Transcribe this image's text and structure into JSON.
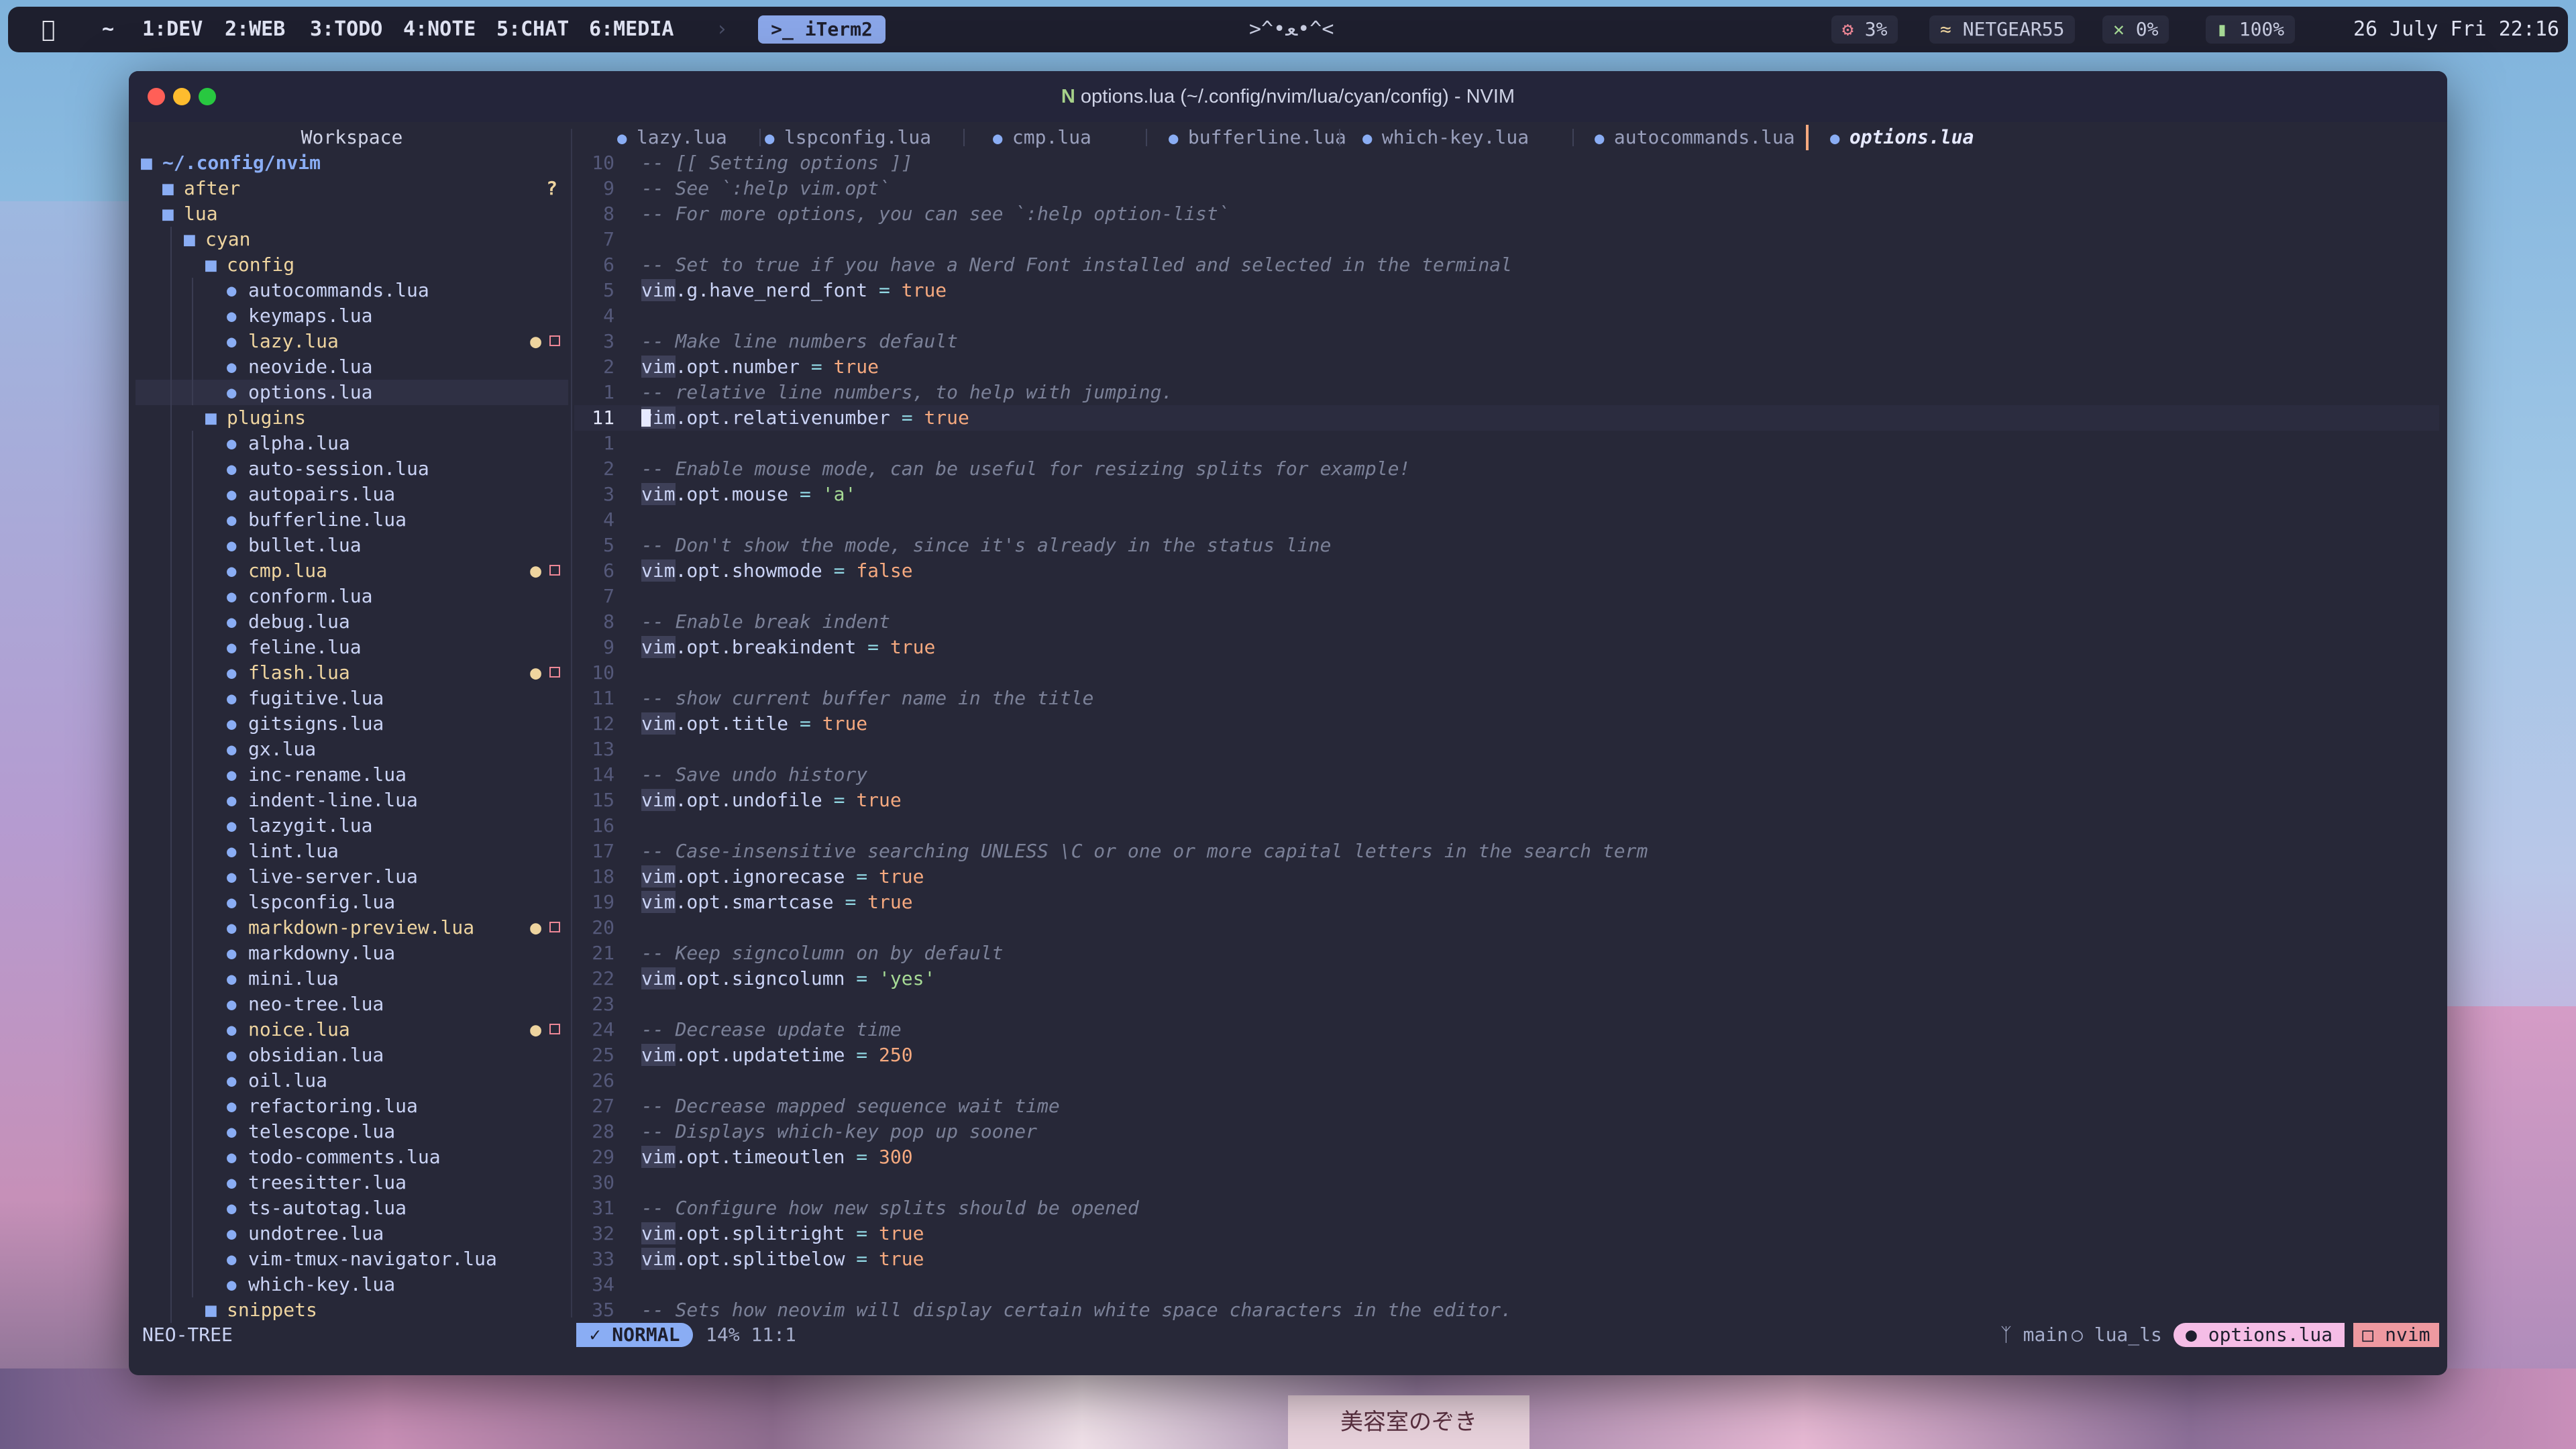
{
  "menubar": {
    "home": "~",
    "workspaces": [
      "1:DEV",
      "2:WEB",
      "3:TODO",
      "4:NOTE",
      "5:CHAT",
      "6:MEDIA"
    ],
    "active_app": "iTerm2",
    "kaomoji": ">^•ﻌ•^<",
    "cpu": "3%",
    "wifi": "NETGEAR55",
    "volume": "0%",
    "battery": "100%",
    "clock": "26 July Fri 22:16"
  },
  "window": {
    "title": "options.lua (~/.config/nvim/lua/cyan/config) - NVIM"
  },
  "sidebar": {
    "title": "Workspace",
    "root": "~/.config/nvim",
    "after": "after",
    "lua": "lua",
    "cyan": "cyan",
    "config": "config",
    "config_files": [
      "autocommands.lua",
      "keymaps.lua",
      "lazy.lua",
      "neovide.lua",
      "options.lua"
    ],
    "plugins": "plugins",
    "plugin_files": [
      "alpha.lua",
      "auto-session.lua",
      "autopairs.lua",
      "bufferline.lua",
      "bullet.lua",
      "cmp.lua",
      "conform.lua",
      "debug.lua",
      "feline.lua",
      "flash.lua",
      "fugitive.lua",
      "gitsigns.lua",
      "gx.lua",
      "inc-rename.lua",
      "indent-line.lua",
      "lazygit.lua",
      "lint.lua",
      "live-server.lua",
      "lspconfig.lua",
      "markdown-preview.lua",
      "markdowny.lua",
      "mini.lua",
      "neo-tree.lua",
      "noice.lua",
      "obsidian.lua",
      "oil.lua",
      "refactoring.lua",
      "telescope.lua",
      "todo-comments.lua",
      "treesitter.lua",
      "ts-autotag.lua",
      "undotree.lua",
      "vim-tmux-navigator.lua",
      "which-key.lua"
    ],
    "snippets": "snippets",
    "modified": [
      "lazy.lua",
      "cmp.lua",
      "flash.lua",
      "markdown-preview.lua",
      "noice.lua"
    ],
    "unknown_marker": "?"
  },
  "tabs": [
    "lazy.lua",
    "lspconfig.lua",
    "cmp.lua",
    "bufferline.lua",
    "which-key.lua",
    "autocommands.lua",
    "options.lua"
  ],
  "active_tab": "options.lua",
  "editor": {
    "lines": [
      {
        "n": "10",
        "t": "-- [[ Setting options ]]"
      },
      {
        "n": "9",
        "t": "-- See `:help vim.opt`"
      },
      {
        "n": "8",
        "t": "-- For more options, you can see `:help option-list`"
      },
      {
        "n": "7",
        "t": ""
      },
      {
        "n": "6",
        "t": "-- Set to true if you have a Nerd Font installed and selected in the terminal"
      },
      {
        "n": "5",
        "t": "vim.g.have_nerd_font = true"
      },
      {
        "n": "4",
        "t": ""
      },
      {
        "n": "3",
        "t": "-- Make line numbers default"
      },
      {
        "n": "2",
        "t": "vim.opt.number = true"
      },
      {
        "n": "1",
        "t": "-- relative line numbers, to help with jumping."
      },
      {
        "n": "11",
        "t": "vim.opt.relativenumber = true"
      },
      {
        "n": "1",
        "t": ""
      },
      {
        "n": "2",
        "t": "-- Enable mouse mode, can be useful for resizing splits for example!"
      },
      {
        "n": "3",
        "t": "vim.opt.mouse = 'a'"
      },
      {
        "n": "4",
        "t": ""
      },
      {
        "n": "5",
        "t": "-- Don't show the mode, since it's already in the status line"
      },
      {
        "n": "6",
        "t": "vim.opt.showmode = false"
      },
      {
        "n": "7",
        "t": ""
      },
      {
        "n": "8",
        "t": "-- Enable break indent"
      },
      {
        "n": "9",
        "t": "vim.opt.breakindent = true"
      },
      {
        "n": "10",
        "t": ""
      },
      {
        "n": "11",
        "t": "-- show current buffer name in the title"
      },
      {
        "n": "12",
        "t": "vim.opt.title = true"
      },
      {
        "n": "13",
        "t": ""
      },
      {
        "n": "14",
        "t": "-- Save undo history"
      },
      {
        "n": "15",
        "t": "vim.opt.undofile = true"
      },
      {
        "n": "16",
        "t": ""
      },
      {
        "n": "17",
        "t": "-- Case-insensitive searching UNLESS \\C or one or more capital letters in the search term"
      },
      {
        "n": "18",
        "t": "vim.opt.ignorecase = true"
      },
      {
        "n": "19",
        "t": "vim.opt.smartcase = true"
      },
      {
        "n": "20",
        "t": ""
      },
      {
        "n": "21",
        "t": "-- Keep signcolumn on by default"
      },
      {
        "n": "22",
        "t": "vim.opt.signcolumn = 'yes'"
      },
      {
        "n": "23",
        "t": ""
      },
      {
        "n": "24",
        "t": "-- Decrease update time"
      },
      {
        "n": "25",
        "t": "vim.opt.updatetime = 250"
      },
      {
        "n": "26",
        "t": ""
      },
      {
        "n": "27",
        "t": "-- Decrease mapped sequence wait time"
      },
      {
        "n": "28",
        "t": "-- Displays which-key pop up sooner"
      },
      {
        "n": "29",
        "t": "vim.opt.timeoutlen = 300"
      },
      {
        "n": "30",
        "t": ""
      },
      {
        "n": "31",
        "t": "-- Configure how new splits should be opened"
      },
      {
        "n": "32",
        "t": "vim.opt.splitright = true"
      },
      {
        "n": "33",
        "t": "vim.opt.splitbelow = true"
      },
      {
        "n": "34",
        "t": ""
      },
      {
        "n": "35",
        "t": "-- Sets how neovim will display certain white space characters in the editor."
      }
    ],
    "current_line_index": 10
  },
  "statusline": {
    "left_panel": "NEO-TREE",
    "mode": "NORMAL",
    "position": "14% 11:1",
    "branch": "main",
    "lsp": "lua_ls",
    "file": "options.lua",
    "project": "nvim"
  },
  "wallpaper": {
    "sign_text": "美容室のぞき"
  },
  "colors": {
    "bg": "#272838",
    "accent": "#8aadf4",
    "modified": "#eed49f",
    "comment": "#7b8198",
    "boolean": "#f5a97f",
    "string": "#a6da95"
  }
}
